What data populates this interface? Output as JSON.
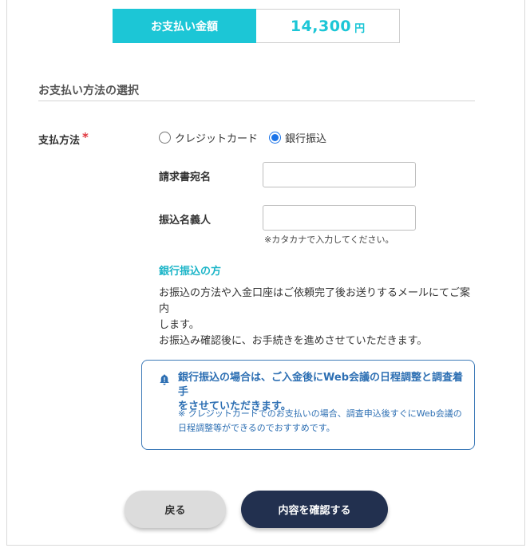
{
  "payment": {
    "label": "お支払い金額",
    "amount": "14,300",
    "unit": "円"
  },
  "section": {
    "title": "お支払い方法の選択"
  },
  "method": {
    "label": "支払方法",
    "required_mark": "*",
    "options": [
      {
        "label": "クレジットカード",
        "checked": false
      },
      {
        "label": "銀行振込",
        "checked": true
      }
    ]
  },
  "invoice": {
    "label": "請求書宛名",
    "value": ""
  },
  "transfer_name": {
    "label": "振込名義人",
    "value": "",
    "hint": "※カタカナで入力してください。"
  },
  "bank": {
    "heading": "銀行振込の方",
    "line1": "お振込の方法や入金口座はご依頼完了後お送りするメールにてご案内",
    "line2": "します。",
    "line3": "お振込み確認後に、お手続きを進めさせていただきます。"
  },
  "notice": {
    "icon": "bell-icon",
    "main_line1": "銀行振込の場合は、ご入金後にWeb会議の日程調整と調査着手",
    "main_line2": "をさせていただきます。",
    "sub_line1": "※ クレジットカードでのお支払いの場合、調査申込後すぐにWeb会議の",
    "sub_line2": "日程調整等ができるのでおすすめです。"
  },
  "buttons": {
    "back": "戻る",
    "confirm": "内容を確認する"
  },
  "colors": {
    "accent": "#1cc6d6",
    "notice": "#2d6fb3",
    "confirm_button": "#22304f",
    "required": "#e0333a"
  }
}
